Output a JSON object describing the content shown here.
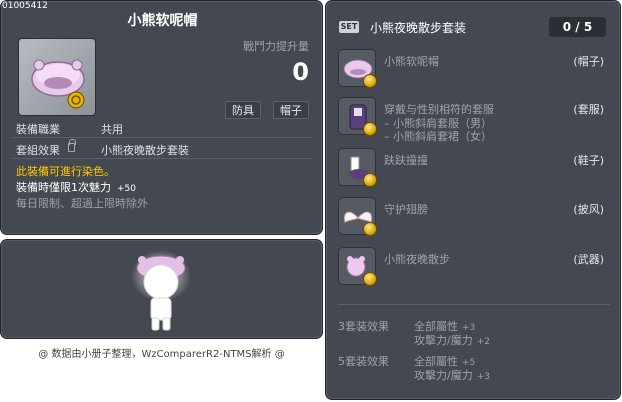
{
  "item": {
    "id": "01005412",
    "title": "小熊软呢帽",
    "power_label": "戰鬥力提升量",
    "power_value": "0",
    "tags": [
      "防具",
      "帽子"
    ],
    "job_label": "裝備職業",
    "job_value": "共用",
    "set_label": "套組效果",
    "set_value": "小熊夜晚散步套裝",
    "dye_note": "此裝備可進行染色。",
    "charm_text": "裝備時僅限1次魅力",
    "charm_value": "+50",
    "daily_note": "每日限制、超過上限時除外"
  },
  "footer": "@ 数据由小册子整理，WzComparerR2-NTMS解析 @",
  "set": {
    "badge": "SET",
    "title": "小熊夜晚散步套装",
    "count": "0 / 5",
    "items": [
      {
        "name": "小熊软呢帽",
        "category": "(帽子)",
        "subs": []
      },
      {
        "name": "穿戴与性别相符的套服",
        "category": "(套服)",
        "subs": [
          "– 小熊斜肩套服（男）",
          "– 小熊斜肩套裙（女）"
        ]
      },
      {
        "name": "趺趺撞撞",
        "category": "(鞋子)",
        "subs": []
      },
      {
        "name": "守护翅膀",
        "category": "(披风)",
        "subs": []
      },
      {
        "name": "小熊夜晚散步",
        "category": "(武器)",
        "subs": []
      }
    ],
    "bonuses": [
      {
        "title": "3套装效果",
        "stat1": "全部屬性",
        "val1": "+3",
        "stat2": "攻擊力/魔力",
        "val2": "+2"
      },
      {
        "title": "5套装效果",
        "stat1": "全部屬性",
        "val1": "+5",
        "stat2": "攻擊力/魔力",
        "val2": "+3"
      }
    ]
  }
}
